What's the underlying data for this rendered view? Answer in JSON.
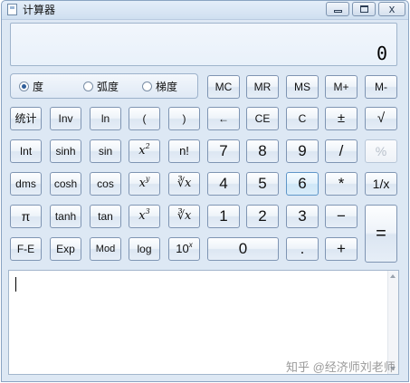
{
  "window": {
    "title": "计算器",
    "close_label": "x"
  },
  "display": {
    "value": "0"
  },
  "angle_modes": [
    {
      "label": "度",
      "selected": true
    },
    {
      "label": "弧度",
      "selected": false
    },
    {
      "label": "梯度",
      "selected": false
    }
  ],
  "memory": {
    "mc": "MC",
    "mr": "MR",
    "ms": "MS",
    "mplus": "M+",
    "mminus": "M-"
  },
  "buttons": {
    "stats": "统计",
    "inv": "Inv",
    "ln": "ln",
    "lparen": "(",
    "rparen": ")",
    "backspace": "←",
    "ce": "CE",
    "c": "C",
    "plusminus": "±",
    "sqrt": "√",
    "int": "Int",
    "sinh": "sinh",
    "sin": "sin",
    "x2_base": "x",
    "x2_exp": "2",
    "factorial": "n!",
    "seven": "7",
    "eight": "8",
    "nine": "9",
    "divide": "/",
    "percent": "%",
    "dms": "dms",
    "cosh": "cosh",
    "cos": "cos",
    "xy_base": "x",
    "xy_exp": "y",
    "yroot": "∛x",
    "four": "4",
    "five": "5",
    "six": "6",
    "multiply": "*",
    "reciprocal": "1/x",
    "pi": "π",
    "tanh": "tanh",
    "tan": "tan",
    "x3_base": "x",
    "x3_exp": "3",
    "cuberoot": "∛x",
    "one": "1",
    "two": "2",
    "three": "3",
    "minus": "−",
    "equals": "=",
    "fe": "F-E",
    "exp": "Exp",
    "mod": "Mod",
    "log": "log",
    "ten_base": "10",
    "ten_exp": "x",
    "zero": "0",
    "decimal": ".",
    "plus": "+"
  },
  "watermark": "知乎 @经济师刘老师"
}
